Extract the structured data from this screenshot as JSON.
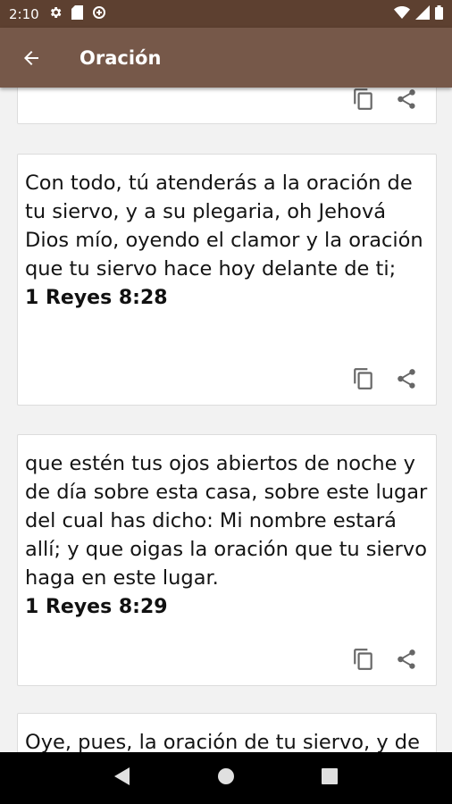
{
  "status_bar": {
    "time": "2:10"
  },
  "app_bar": {
    "title": "Oración"
  },
  "cards": [
    {
      "verse": "Con todo, tú atenderás a la oración de tu siervo, y a su plegaria, oh Jehová Dios mío, oyendo el clamor y la oración que tu siervo hace hoy delante de ti;",
      "reference": "1 Reyes 8:28"
    },
    {
      "verse": "que estén tus ojos abiertos de noche y de día sobre esta casa, sobre este lugar del cual has dicho: Mi nombre estará allí; y que oigas la oración que tu siervo haga en este lugar.",
      "reference": "1 Reyes 8:29"
    },
    {
      "verse": "Oye, pues, la oración de tu siervo, y de"
    }
  ],
  "icons": {
    "copy": "copy-icon",
    "share": "share-icon",
    "back": "arrow-back-icon"
  },
  "colors": {
    "status_bar": "#5d4030",
    "app_bar": "#765849",
    "background": "#f2f2f2"
  }
}
